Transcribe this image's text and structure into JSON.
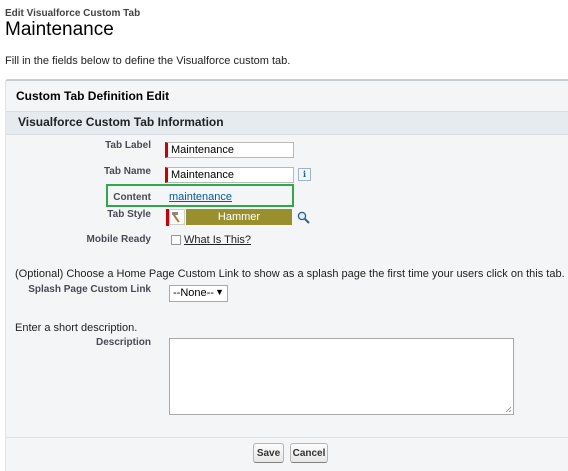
{
  "header": {
    "subtitle": "Edit Visualforce Custom Tab",
    "title": "Maintenance",
    "intro": "Fill in the fields below to define the Visualforce custom tab."
  },
  "panel": {
    "title": "Custom Tab Definition Edit",
    "section_title": "Visualforce Custom Tab Information"
  },
  "fields": {
    "tab_label": {
      "label": "Tab Label",
      "value": "Maintenance"
    },
    "tab_name": {
      "label": "Tab Name",
      "value": "Maintenance",
      "info_icon": "info-icon"
    },
    "content": {
      "label": "Content",
      "value": "maintenance"
    },
    "tab_style": {
      "label": "Tab Style",
      "value": "Hammer",
      "swatch_color": "#9a8f2d",
      "icon": "hammer-icon",
      "lookup_icon": "magnifier-icon"
    },
    "mobile_ready": {
      "label": "Mobile Ready",
      "checked": false,
      "help_link": "What Is This?"
    }
  },
  "splash": {
    "optional_text": "(Optional) Choose a Home Page Custom Link to show as a splash page the first time your users click on this tab.",
    "label": "Splash Page Custom Link",
    "selected": "--None--"
  },
  "description": {
    "intro": "Enter a short description.",
    "label": "Description",
    "value": ""
  },
  "buttons": {
    "save": "Save",
    "cancel": "Cancel"
  },
  "colors": {
    "required_marker": "#cc0000",
    "highlight_box": "#2fa84c",
    "link": "#015ba7",
    "section_bar": "#e6ebef"
  }
}
